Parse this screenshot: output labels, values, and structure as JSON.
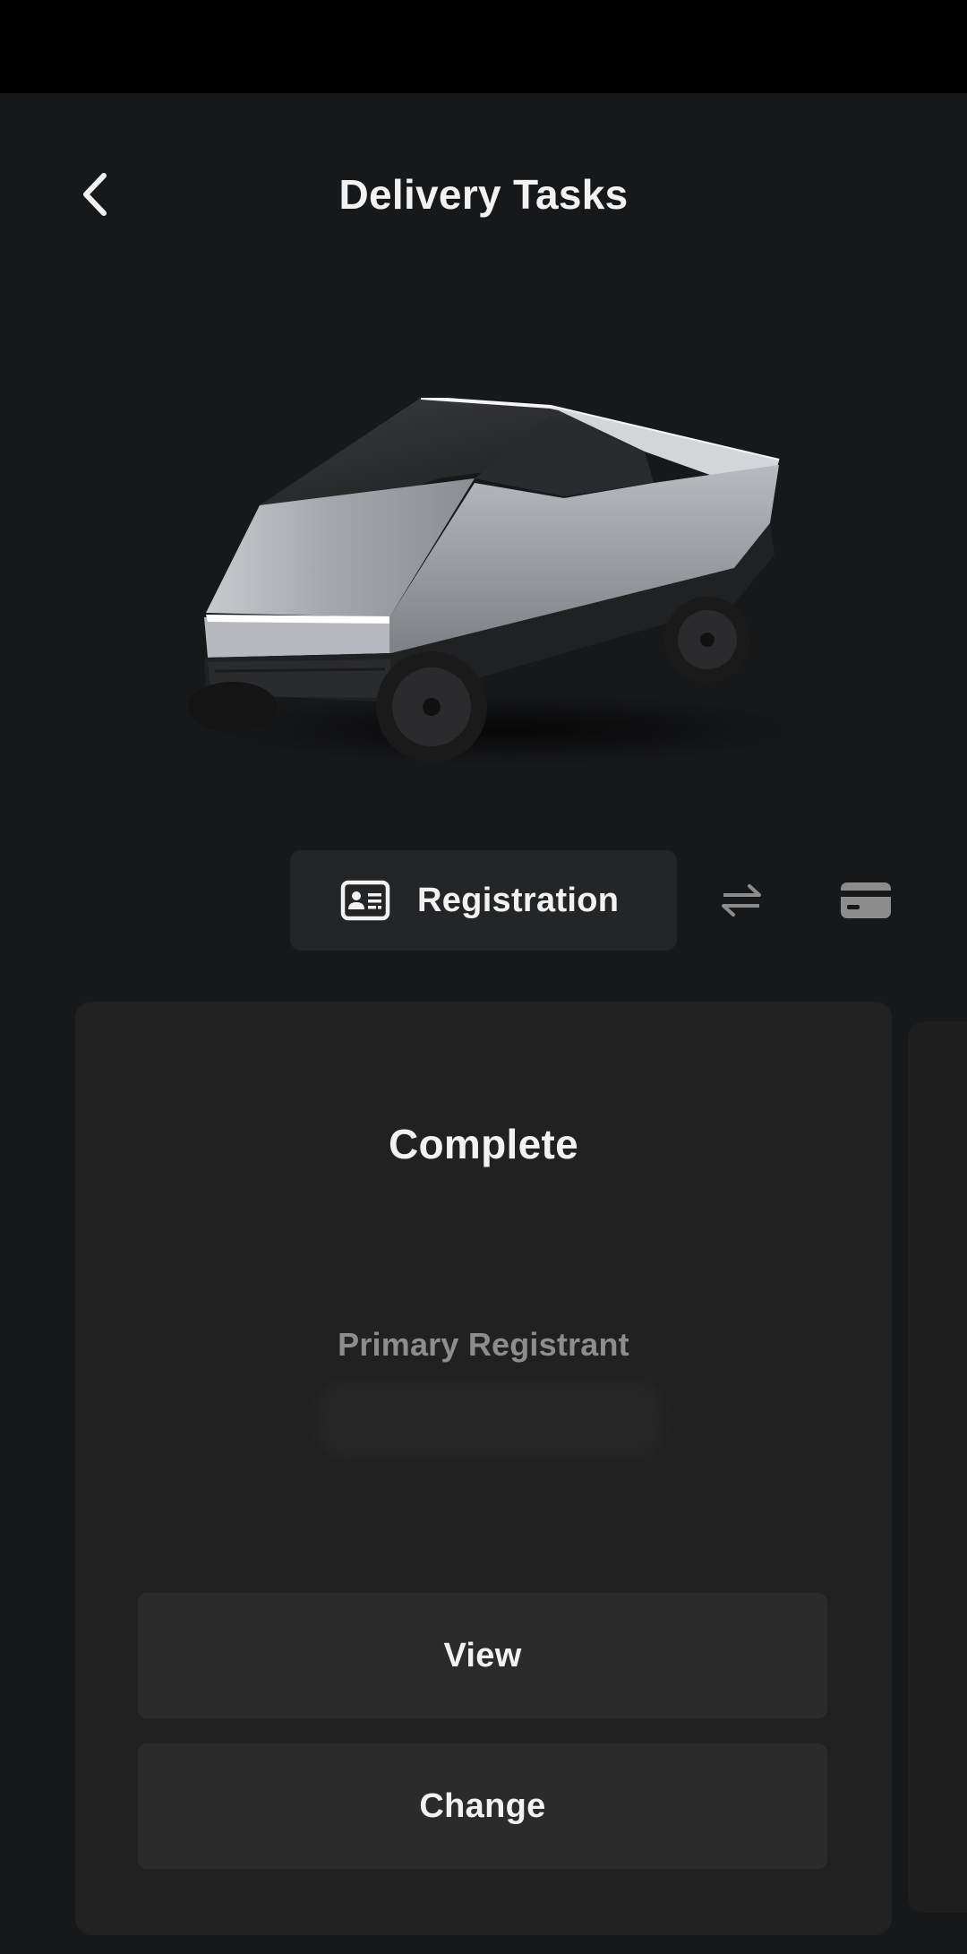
{
  "header": {
    "title": "Delivery Tasks",
    "back_icon": "chevron-left-icon"
  },
  "vehicle": {
    "image": "cybertruck-image",
    "body_color": "#a6a8ad"
  },
  "tabs": {
    "active": {
      "label": "Registration",
      "icon": "id-card-icon"
    },
    "others": [
      {
        "icon": "transfer-arrows-icon"
      },
      {
        "icon": "payment-card-icon"
      }
    ]
  },
  "card": {
    "status": "Complete",
    "registrant_label": "Primary Registrant",
    "buttons": {
      "view": "View",
      "change": "Change"
    }
  },
  "colors": {
    "background": "#17181a",
    "card": "#212121",
    "button": "#2b2b2b",
    "text": "#f2f2f2",
    "muted_text": "#8d8d8e",
    "status_bar": "#000000"
  }
}
